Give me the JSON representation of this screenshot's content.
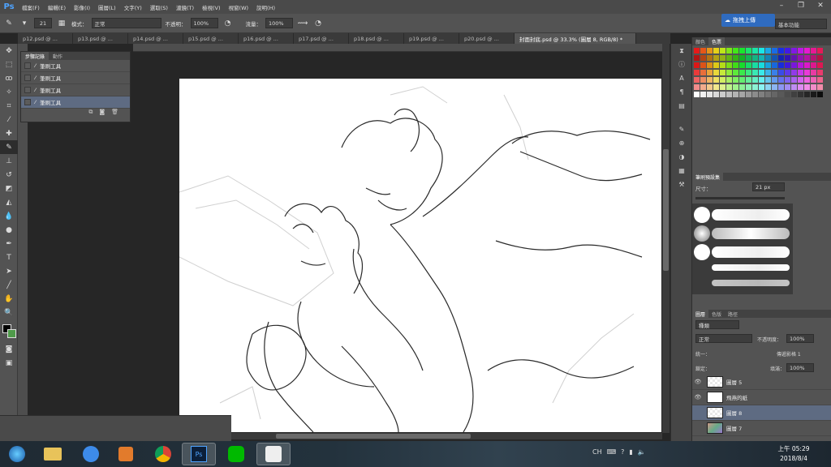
{
  "menubar": {
    "app_logo": "Ps",
    "items": [
      "檔案(F)",
      "編輯(E)",
      "影像(I)",
      "圖層(L)",
      "文字(Y)",
      "選取(S)",
      "濾鏡(T)",
      "檢視(V)",
      "視窗(W)",
      "說明(H)"
    ]
  },
  "options": {
    "brush_size": "21",
    "mode_label": "模式：",
    "mode_value": "正常",
    "opacity_label": "不透明：",
    "opacity_value": "100%",
    "flow_label": "流量：",
    "flow_value": "100%",
    "upload_label": "拖拽上傳",
    "workspace_value": "基本功能"
  },
  "tabs": [
    "p12.psd @ ...",
    "p13.psd @ ...",
    "p14.psd @ ...",
    "p15.psd @ ...",
    "p16.psd @ ...",
    "p17.psd @ ...",
    "p18.psd @ ...",
    "p19.psd @ ...",
    "p20.psd @ ...",
    "封面封底.psd @ 33.3% (圖層 8, RGB/8) *"
  ],
  "history": {
    "tabs": [
      "步驟記錄",
      "動作"
    ],
    "rows": [
      "筆刷工具",
      "筆刷工具",
      "筆刷工具",
      "筆刷工具"
    ]
  },
  "swatches_panel": {
    "tabs": [
      "顏色",
      "色票"
    ]
  },
  "brush_panel": {
    "tabs": [
      "筆刷預設集"
    ],
    "size_label": "尺寸：",
    "size_value": "21 px"
  },
  "layers_panel": {
    "tabs": [
      "圖層",
      "色版",
      "路徑"
    ],
    "filter": "種類",
    "blend": "正常",
    "opacity_label": "不透明度：",
    "opacity_value": "100%",
    "unify_label": "統一：",
    "propagate_label": "傳遞影格 1",
    "lock_label": "鎖定：",
    "fill_label": "填滿：",
    "fill_value": "100%",
    "layers": [
      "圖層 5",
      "飛燕的紙",
      "圖層 8",
      "圖層 7"
    ]
  },
  "colors": {
    "accent": "#2f6bbf",
    "selection": "#5e6b82",
    "panel": "#535353"
  },
  "taskbar": {
    "apps": [
      "windows-start-icon",
      "file-explorer-icon",
      "baidu-cloud-icon",
      "media-player-icon",
      "chrome-icon",
      "photoshop-icon",
      "line-icon",
      "sai-icon"
    ],
    "time": "上午 05:29",
    "date": "2018/8/4",
    "ime": "CH"
  }
}
